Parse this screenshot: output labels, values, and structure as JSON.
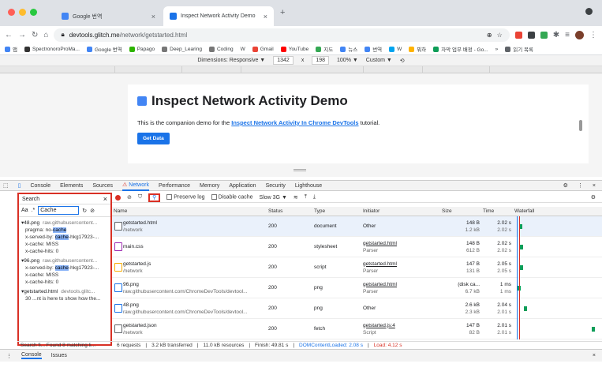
{
  "browser": {
    "tabs": [
      {
        "label": "Google 번역",
        "active": false
      },
      {
        "label": "Inspect Network Activity Demo",
        "active": true
      }
    ],
    "new_tab": "+",
    "url_host": "devtools.glitch.me",
    "url_path": "/network/getstarted.html",
    "bookmarks": [
      "앱",
      "SpectronoroProMa...",
      "Google 번역",
      "Papago",
      "Deep_Learing",
      "Coding",
      "W",
      "Gmail",
      "YouTube",
      "지도",
      "뉴스",
      "번역",
      "W",
      "뭐하",
      "자막 업무 배정 - Go...",
      "»",
      "읽기 목록"
    ]
  },
  "device_toolbar": {
    "dimensions": "Dimensions: Responsive ▼",
    "width": "1342",
    "times": "x",
    "height": "198",
    "zoom": "100% ▼",
    "custom": "Custom ▼"
  },
  "page": {
    "title": "Inspect Network Activity Demo",
    "desc_prefix": "This is the companion demo for the",
    "desc_link": "Inspect Network Activity In Chrome DevTools",
    "desc_suffix": "tutorial.",
    "button": "Get Data"
  },
  "devtools": {
    "tabs": [
      "Console",
      "Elements",
      "Sources",
      "Network",
      "Performance",
      "Memory",
      "Application",
      "Security",
      "Lighthouse"
    ],
    "active_tab": "Network",
    "search": {
      "title": "Search",
      "case_label": "Aa",
      "regex_label": ".*",
      "query": "Cache",
      "results": [
        {
          "file": "▾48.png",
          "url": "raw.githubusercontent...",
          "lines": [
            [
              "pragma: no-",
              "cache",
              ""
            ],
            [
              "x-served-by: ",
              "cache",
              "-hkg17923-..."
            ],
            [
              "x-cache: MISS",
              "",
              ""
            ],
            [
              "x-cache-hits: 0",
              "",
              ""
            ]
          ]
        },
        {
          "file": "▾96.png",
          "url": "raw.githubusercontent...",
          "lines": [
            [
              "x-served-by: ",
              "cache",
              "-hkg17923-..."
            ],
            [
              "x-cache: MISS",
              "",
              ""
            ],
            [
              "x-cache-hits: 0",
              "",
              ""
            ]
          ]
        },
        {
          "file": "▾getstarted.html",
          "url": "devtools.glitc...",
          "lines": [
            [
              "30 ...nt is here to show how the...",
              "",
              ""
            ]
          ]
        }
      ],
      "status": "Search fi...  Found 8 matching li..."
    },
    "net_toolbar": {
      "preserve_log": "Preserve log",
      "disable_cache": "Disable cache",
      "throttle": "Slow 3G",
      "throttle_arrow": "▼"
    },
    "table": {
      "columns": [
        "Name",
        "Status",
        "Type",
        "Initiator",
        "Size",
        "Time",
        "Waterfall"
      ],
      "rows": [
        {
          "name": "getstarted.html",
          "path": "/network",
          "status": "200",
          "type": "document",
          "initiator": "Other",
          "initiator_sub": "",
          "size": "148 B",
          "size2": "1.2 kB",
          "time": "2.02 s",
          "time2": "2.02 s",
          "icon": "doc",
          "wf": 0.02
        },
        {
          "name": "main.css",
          "path": "",
          "status": "200",
          "type": "stylesheet",
          "initiator": "getstarted.html",
          "initiator_sub": "Parser",
          "size": "148 B",
          "size2": "612 B",
          "time": "2.02 s",
          "time2": "2.02 s",
          "icon": "css",
          "wf": 0.03
        },
        {
          "name": "getstarted.js",
          "path": "/network",
          "status": "200",
          "type": "script",
          "initiator": "getstarted.html",
          "initiator_sub": "Parser",
          "size": "147 B",
          "size2": "131 B",
          "time": "2.05 s",
          "time2": "2.05 s",
          "icon": "js",
          "wf": 0.03
        },
        {
          "name": "96.png",
          "path": "raw.githubusercontent.com/ChromeDevTools/devtool...",
          "status": "200",
          "type": "png",
          "initiator": "getstarted.html",
          "initiator_sub": "Parser",
          "size": "(disk ca...",
          "size2": "6.7 kB",
          "time": "1 ms",
          "time2": "1 ms",
          "icon": "img",
          "wf": 0.005
        },
        {
          "name": "48.png",
          "path": "raw.githubusercontent.com/ChromeDevTools/devtool...",
          "status": "200",
          "type": "png",
          "initiator": "Other",
          "initiator_sub": "",
          "size": "2.6 kB",
          "size2": "2.3 kB",
          "time": "2.04 s",
          "time2": "2.01 s",
          "icon": "img",
          "wf": 0.08
        },
        {
          "name": "getstarted.json",
          "path": "/network",
          "status": "200",
          "type": "fetch",
          "initiator": "getstarted.js:4",
          "initiator_sub": "Script",
          "size": "147 B",
          "size2": "82 B",
          "time": "2.01 s",
          "time2": "2.01 s",
          "icon": "doc",
          "wf": 0.95
        }
      ]
    },
    "summary": {
      "requests": "6 requests",
      "transferred": "3.2 kB transferred",
      "resources": "11.0 kB resources",
      "finish": "Finish: 49.81 s",
      "dcl": "DOMContentLoaded: 2.08 s",
      "load": "Load: 4.12 s"
    },
    "drawer": [
      "Console",
      "Issues"
    ]
  },
  "colors": {
    "accent": "#1a73e8",
    "highlight": "#d93025",
    "waterfall": "#0f9d58"
  }
}
